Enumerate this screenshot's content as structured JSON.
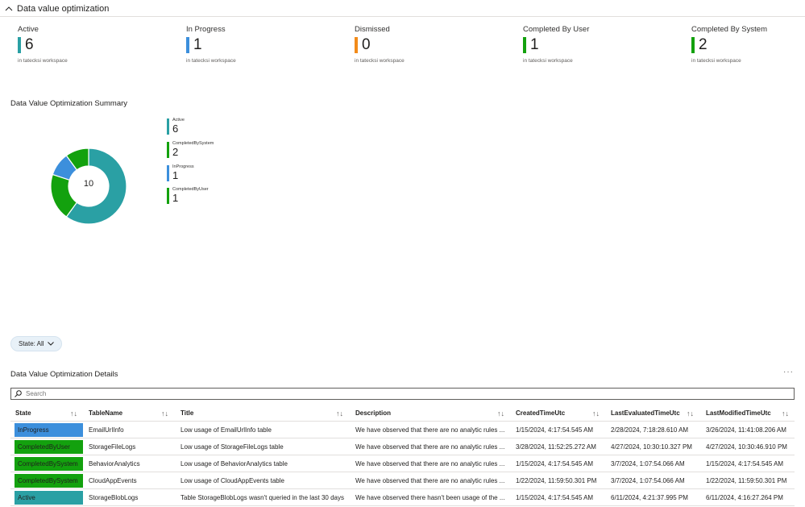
{
  "section": {
    "title": "Data value optimization"
  },
  "tiles": [
    {
      "label": "Active",
      "value": "6",
      "sub": "in tatecksi workspace",
      "color": "#2aa0a4"
    },
    {
      "label": "In Progress",
      "value": "1",
      "sub": "in tatecksi workspace",
      "color": "#3c8fdc"
    },
    {
      "label": "Dismissed",
      "value": "0",
      "sub": "in tatecksi workspace",
      "color": "#f28b1a"
    },
    {
      "label": "Completed By User",
      "value": "1",
      "sub": "in tatecksi workspace",
      "color": "#13a10e"
    },
    {
      "label": "Completed By System",
      "value": "2",
      "sub": "in tatecksi workspace",
      "color": "#13a10e"
    }
  ],
  "summary": {
    "title": "Data Value Optimization Summary",
    "total": "10",
    "legend": [
      {
        "name": "Active",
        "value": "6",
        "color": "#2aa0a4"
      },
      {
        "name": "CompletedBySystem",
        "value": "2",
        "color": "#13a10e"
      },
      {
        "name": "InProgress",
        "value": "1",
        "color": "#3c8fdc"
      },
      {
        "name": "CompletedByUser",
        "value": "1",
        "color": "#13a10e"
      }
    ]
  },
  "chart_data": {
    "type": "pie",
    "categories": [
      "Active",
      "CompletedBySystem",
      "InProgress",
      "CompletedByUser"
    ],
    "values": [
      6,
      2,
      1,
      1
    ],
    "colors": [
      "#2aa0a4",
      "#13a10e",
      "#3c8fdc",
      "#13a10e"
    ],
    "title": "Data Value Optimization Summary",
    "center_label": "10",
    "legend_position": "right"
  },
  "filter": {
    "label": "State: All"
  },
  "details": {
    "title": "Data Value Optimization Details",
    "more": "···",
    "search_placeholder": "Search",
    "columns": [
      "State",
      "TableName",
      "Title",
      "Description",
      "CreatedTimeUtc",
      "LastEvaluatedTimeUtc",
      "LastModifiedTimeUtc"
    ],
    "sort_icon": "↑↓",
    "rows": [
      {
        "state": "InProgress",
        "state_color": "#3c8fdc",
        "table": "EmailUrlInfo",
        "title": "Low usage of EmailUrlInfo table",
        "description": "We have observed that there are no analytic rules ...",
        "created": "1/15/2024, 4:17:54.545 AM",
        "evaluated": "2/28/2024, 7:18:28.610 AM",
        "modified": "3/26/2024, 11:41:08.206 AM"
      },
      {
        "state": "CompletedByUser",
        "state_color": "#13a10e",
        "table": "StorageFileLogs",
        "title": "Low usage of StorageFileLogs table",
        "description": "We have observed that there are no analytic rules ...",
        "created": "3/28/2024, 11:52:25.272 AM",
        "evaluated": "4/27/2024, 10:30:10.327 PM",
        "modified": "4/27/2024, 10:30:46.910 PM"
      },
      {
        "state": "CompletedBySystem",
        "state_color": "#13a10e",
        "table": "BehaviorAnalytics",
        "title": "Low usage of BehaviorAnalytics table",
        "description": "We have observed that there are no analytic rules ...",
        "created": "1/15/2024, 4:17:54.545 AM",
        "evaluated": "3/7/2024, 1:07:54.066 AM",
        "modified": "1/15/2024, 4:17:54.545 AM"
      },
      {
        "state": "CompletedBySystem",
        "state_color": "#13a10e",
        "table": "CloudAppEvents",
        "title": "Low usage of CloudAppEvents table",
        "description": "We have observed that there are no analytic rules ...",
        "created": "1/22/2024, 11:59:50.301 PM",
        "evaluated": "3/7/2024, 1:07:54.066 AM",
        "modified": "1/22/2024, 11:59:50.301 PM"
      },
      {
        "state": "Active",
        "state_color": "#2aa0a4",
        "table": "StorageBlobLogs",
        "title": "Table StorageBlobLogs wasn't queried in the last 30 days",
        "description": "We have observed there hasn't been usage of the ...",
        "created": "1/15/2024, 4:17:54.545 AM",
        "evaluated": "6/11/2024, 4:21:37.995 PM",
        "modified": "6/11/2024, 4:16:27.264 PM"
      }
    ]
  }
}
